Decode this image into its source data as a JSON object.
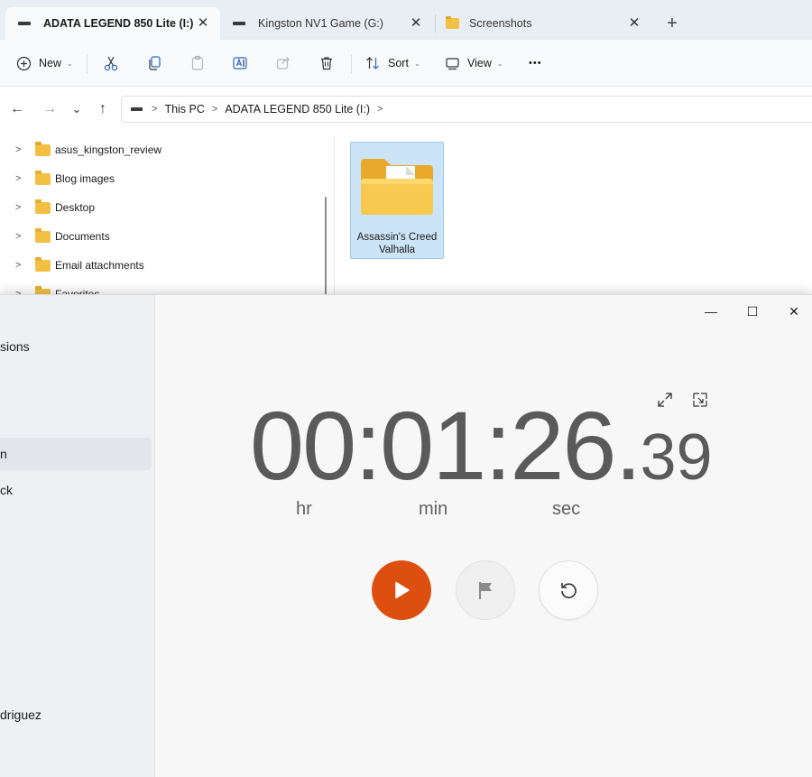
{
  "explorer": {
    "tabs": [
      {
        "label": "ADATA LEGEND 850 Lite (I:)",
        "icon": "drive-icon",
        "active": true
      },
      {
        "label": "Kingston NV1 Game (G:)",
        "icon": "drive-icon",
        "active": false
      },
      {
        "label": "Screenshots",
        "icon": "folder-icon",
        "active": false
      }
    ],
    "tab_close_glyph": "✕",
    "new_tab_glyph": "+",
    "toolbar": {
      "new_label": "New",
      "sort_label": "Sort",
      "view_label": "View",
      "more_glyph": "•••",
      "caret_glyph": "⌄"
    },
    "address": {
      "back_glyph": "←",
      "forward_glyph": "→",
      "recent_glyph": "⌄",
      "up_glyph": "↑",
      "separator_glyph": ">",
      "crumbs": [
        "This PC",
        "ADATA LEGEND 850 Lite (I:)"
      ]
    },
    "nav_pane": {
      "expander_glyph": ">",
      "items": [
        "asus_kingston_review",
        "Blog images",
        "Desktop",
        "Documents",
        "Email attachments",
        "Favorites"
      ]
    },
    "content": {
      "items": [
        {
          "name": "Assassin's Creed Valhalla",
          "selected": true
        }
      ]
    },
    "colors": {
      "folder": "#f3c044",
      "selection": "#cce4f7"
    }
  },
  "clock": {
    "sidebar": {
      "items_cropped": [
        "sions",
        "n",
        "ck",
        "driguez"
      ]
    },
    "window_controls": {
      "minimize": "—",
      "maximize": "☐",
      "close": "✕"
    },
    "stopwatch": {
      "hours": "00",
      "minutes": "01",
      "seconds": "26",
      "hundredths": "39",
      "colon": ":",
      "dot": ".",
      "units": {
        "hr": "hr",
        "min": "min",
        "sec": "sec"
      }
    },
    "colors": {
      "accent": "#dd4f0f"
    }
  }
}
